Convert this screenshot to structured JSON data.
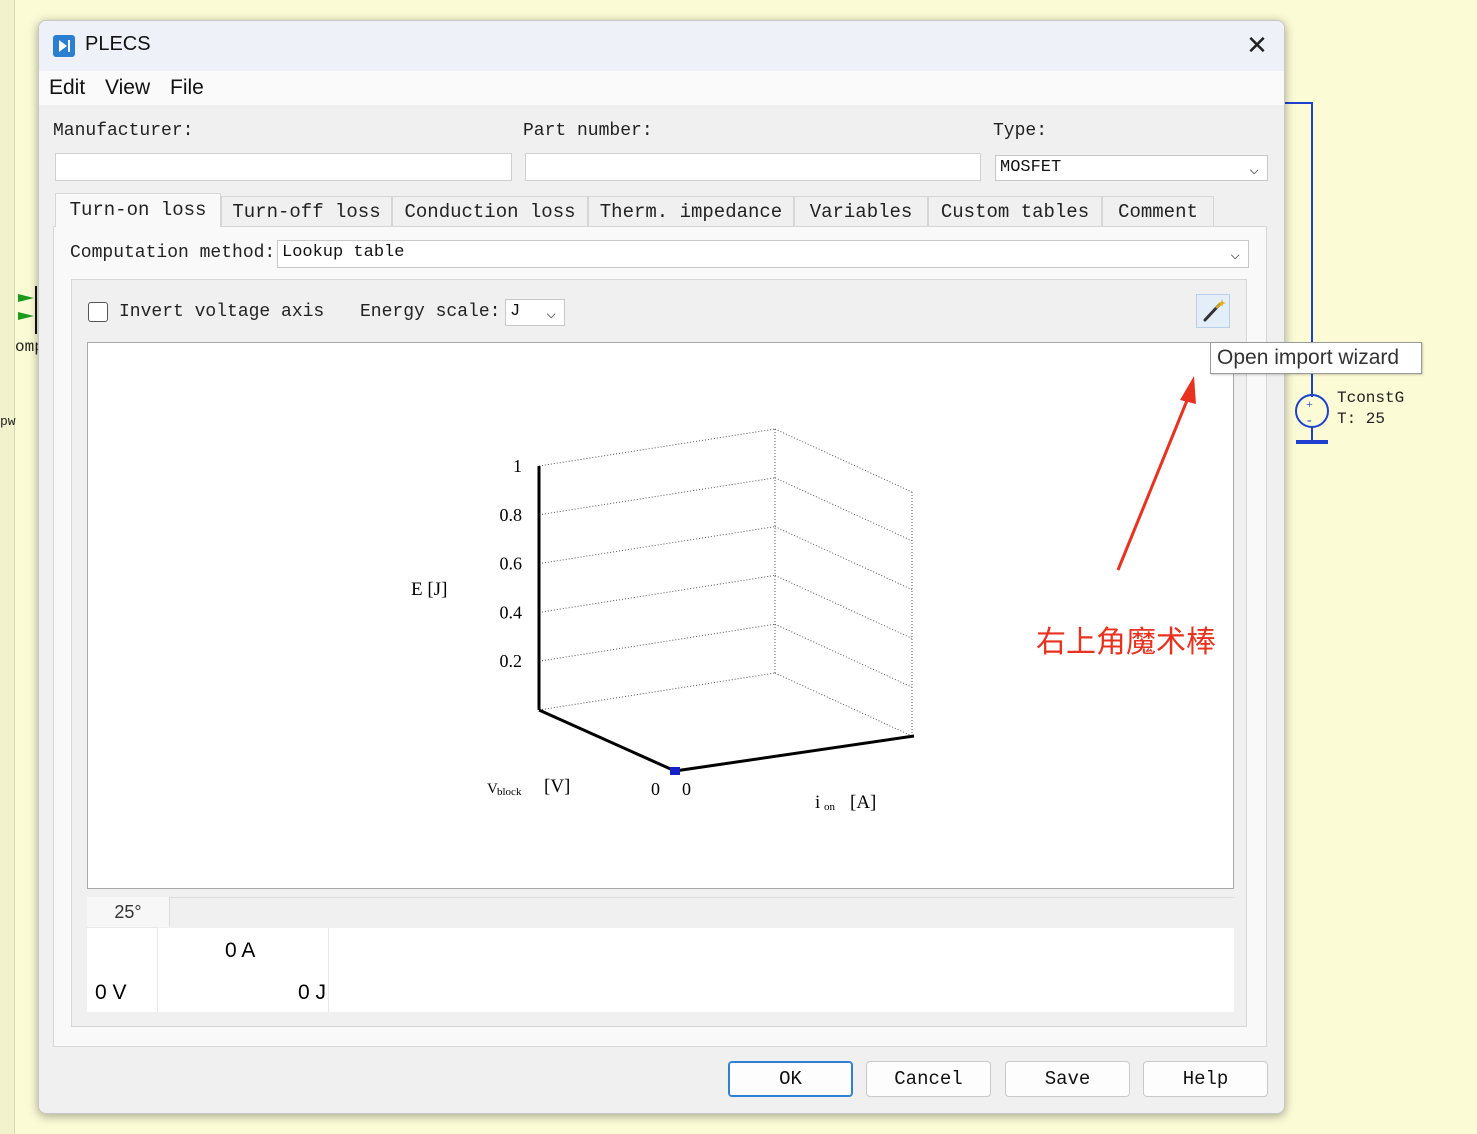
{
  "window": {
    "title": "PLECS",
    "menu": [
      "Edit",
      "View",
      "File"
    ]
  },
  "header": {
    "manufacturer_label": "Manufacturer:",
    "manufacturer_value": "",
    "part_number_label": "Part number:",
    "part_number_value": "",
    "type_label": "Type:",
    "type_value": "MOSFET"
  },
  "tabs": [
    "Turn-on loss",
    "Turn-off loss",
    "Conduction loss",
    "Therm. impedance",
    "Variables",
    "Custom tables",
    "Comment"
  ],
  "active_tab": "Turn-on loss",
  "computation": {
    "label": "Computation method:",
    "value": "Lookup table"
  },
  "options": {
    "invert_label": "Invert voltage axis",
    "invert_checked": false,
    "energy_scale_label": "Energy scale:",
    "energy_scale_value": "J"
  },
  "chart_data": {
    "type": "surface-3d",
    "z_label": "E [J]",
    "z_ticks": [
      "1",
      "0.8",
      "0.6",
      "0.4",
      "0.2"
    ],
    "x_label": "V",
    "x_label_sub": "block",
    "x_unit": "[V]",
    "y_label": "i",
    "y_label_sub": "on",
    "y_unit": "[A]",
    "x_origin_tick": "0",
    "y_origin_tick": "0",
    "points": [
      {
        "v_block": 0,
        "i_on": 0,
        "energy": 0
      }
    ]
  },
  "table": {
    "temperature_tab": "25°",
    "current_header": "0 A",
    "voltage_row": "0 V",
    "energy_value": "0 J"
  },
  "buttons": {
    "ok": "OK",
    "cancel": "Cancel",
    "save": "Save",
    "help": "Help"
  },
  "tooltip": "Open import wizard",
  "annotation": "右上角魔术棒",
  "background": {
    "component_name": "TconstG",
    "component_param": "T: 25",
    "left_text_1": "omp",
    "left_text_2": "pw"
  }
}
